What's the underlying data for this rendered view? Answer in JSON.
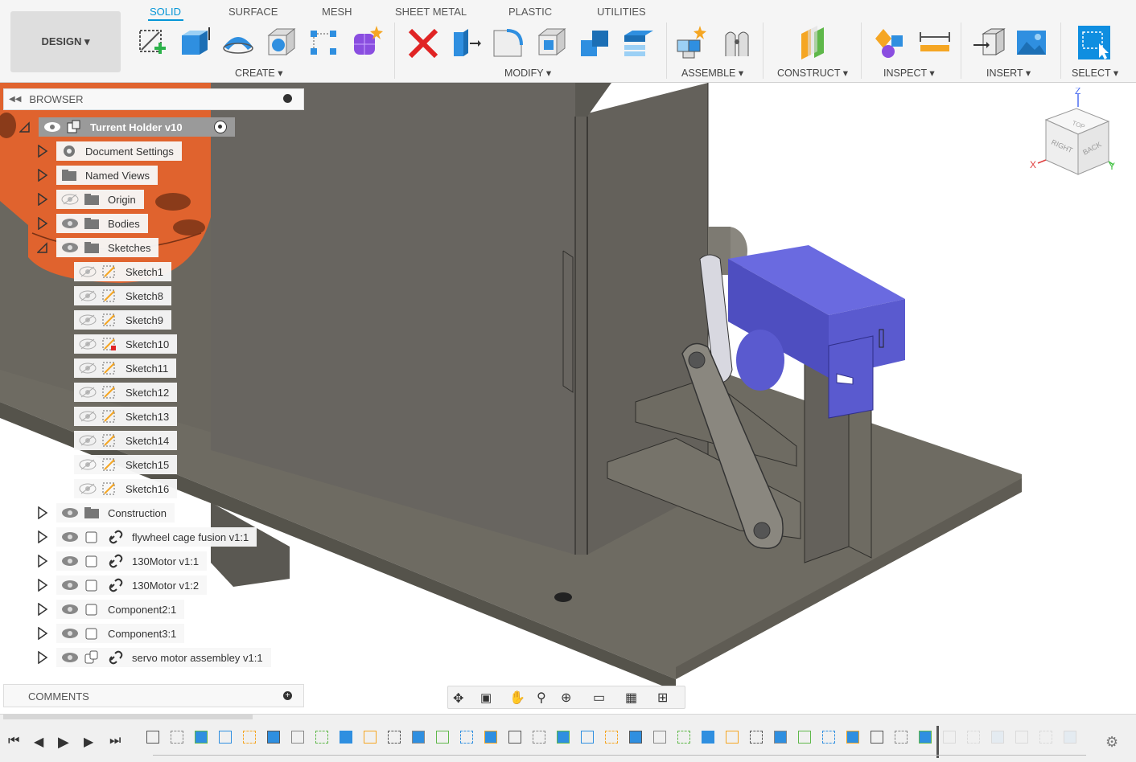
{
  "workspace": {
    "label": "DESIGN ▾"
  },
  "tabs": [
    {
      "label": "SOLID",
      "active": true
    },
    {
      "label": "SURFACE"
    },
    {
      "label": "MESH"
    },
    {
      "label": "SHEET METAL"
    },
    {
      "label": "PLASTIC"
    },
    {
      "label": "UTILITIES"
    }
  ],
  "groups": {
    "create": "CREATE ▾",
    "modify": "MODIFY ▾",
    "assemble": "ASSEMBLE ▾",
    "construct": "CONSTRUCT ▾",
    "inspect": "INSPECT ▾",
    "insert": "INSERT ▾",
    "select": "SELECT ▾"
  },
  "browser": {
    "title": "BROWSER",
    "root": "Turrent Holder v10",
    "nodes": [
      {
        "label": "Document Settings",
        "icon": "gear-icon"
      },
      {
        "label": "Named Views",
        "icon": "folder-icon"
      },
      {
        "label": "Origin",
        "icon": "folder-icon",
        "hidden": true
      },
      {
        "label": "Bodies",
        "icon": "folder-icon"
      },
      {
        "label": "Sketches",
        "icon": "folder-icon",
        "expanded": true
      }
    ],
    "sketches": [
      "Sketch1",
      "Sketch8",
      "Sketch9",
      "Sketch10",
      "Sketch11",
      "Sketch12",
      "Sketch13",
      "Sketch14",
      "Sketch15",
      "Sketch16"
    ],
    "after": [
      {
        "label": "Construction",
        "icon": "folder-icon"
      },
      {
        "label": "flywheel cage fusion v1:1",
        "icon": "component-icon",
        "linked": true
      },
      {
        "label": "130Motor v1:1",
        "icon": "component-icon",
        "linked": true
      },
      {
        "label": "130Motor v1:2",
        "icon": "component-icon",
        "linked": true
      },
      {
        "label": "Component2:1",
        "icon": "component-icon"
      },
      {
        "label": "Component3:1",
        "icon": "component-icon"
      },
      {
        "label": "servo motor assembley v1:1",
        "icon": "assembly-icon",
        "linked": true
      }
    ]
  },
  "comments": {
    "title": "COMMENTS"
  },
  "viewcube": {
    "top": "TOP",
    "right": "RIGHT",
    "back": "BACK",
    "x": "X",
    "y": "Y",
    "z": "Z"
  },
  "colors": {
    "accent": "#0696d7",
    "orange": "#e0632e",
    "servo": "#5a5acf",
    "plate": "#6e6b62"
  }
}
